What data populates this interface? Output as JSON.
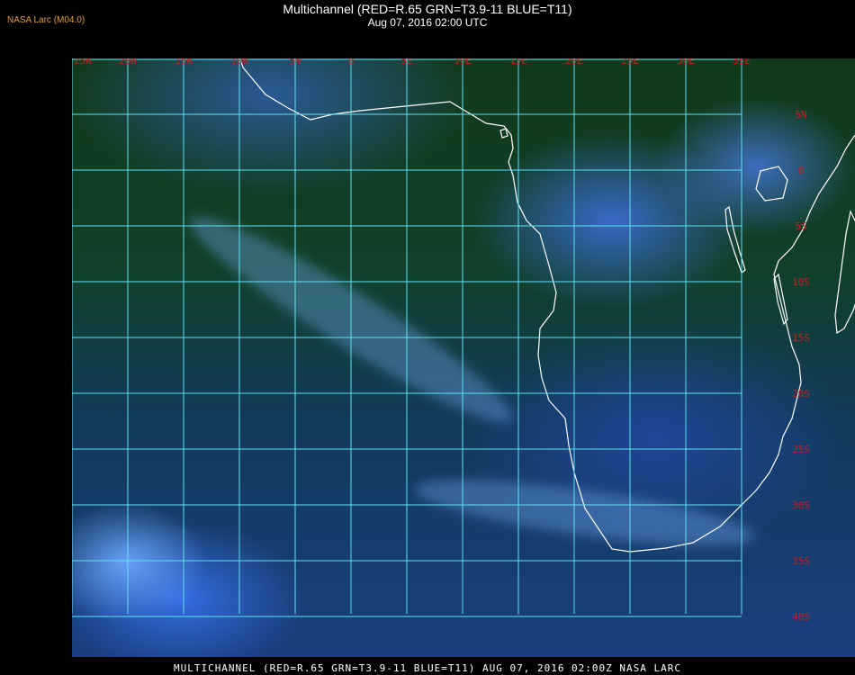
{
  "header": {
    "title": "Multichannel (RED=R.65 GRN=T3.9-11 BLUE=T11)",
    "subtitle": "Aug 07, 2016 02:00 UTC",
    "credit": "NASA Larc (M04.0)"
  },
  "footer": {
    "caption": "MULTICHANNEL (RED=R.65 GRN=T3.9-11 BLUE=T11) AUG 07, 2016 02:00Z   NASA LARC"
  },
  "map": {
    "grid_color": "#5fe0f0",
    "label_color": "#c02020",
    "coast_color": "#ffffff",
    "lon_labels": [
      "25W",
      "20W",
      "15W",
      "10W",
      "5W",
      "0",
      "5E",
      "10E",
      "15E",
      "20E",
      "25E",
      "30E",
      "35E"
    ],
    "lat_labels": [
      "5N",
      "0",
      "5S",
      "10S",
      "15S",
      "20S",
      "25S",
      "30S",
      "35S",
      "40S"
    ]
  }
}
